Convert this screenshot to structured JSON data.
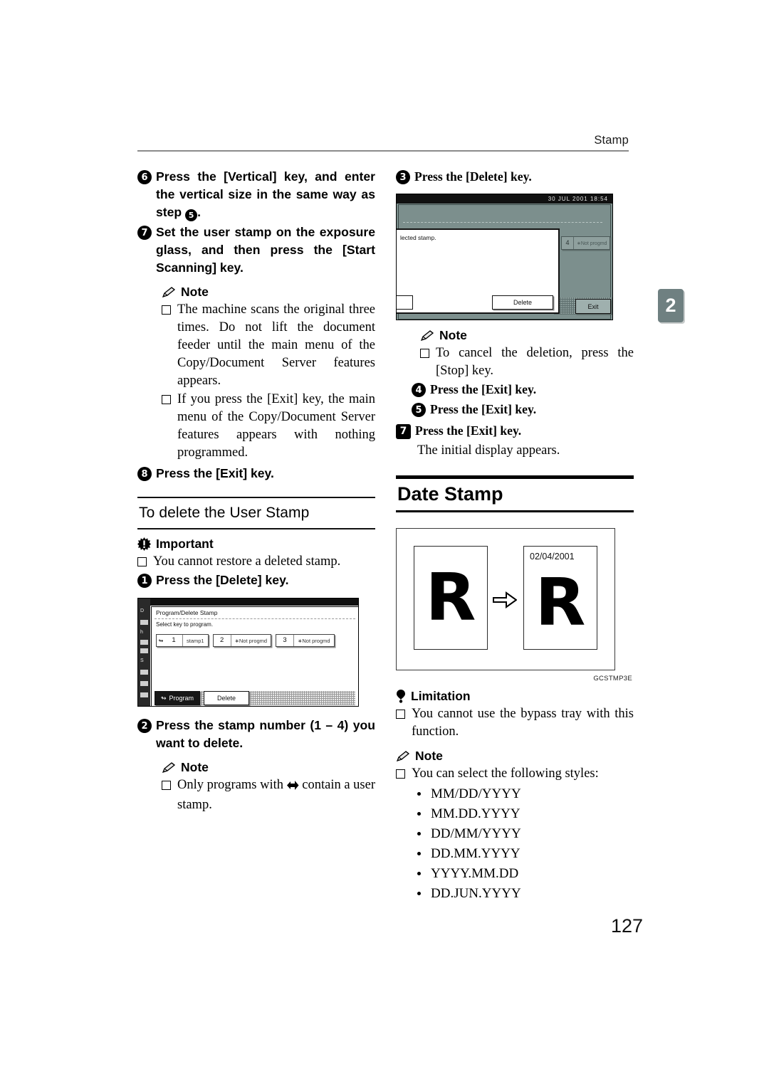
{
  "header": {
    "running_head": "Stamp",
    "chapter_tab": "2"
  },
  "folio": "127",
  "left_column": {
    "step6": {
      "badge": "6",
      "text_pre": "Press the [Vertical] key, and enter the vertical size in the same way as step ",
      "text_post": "."
    },
    "step7": {
      "badge": "7",
      "text": "Set the user stamp on the exposure glass, and then press the [Start Scanning] key."
    },
    "note1": {
      "label": "Note",
      "icon": "pencil-icon",
      "items": [
        "The machine scans the original three times. Do not lift the document feeder until the main menu of the Copy/Document Server features appears.",
        "If you press the [Exit] key, the main menu of the Copy/Document Server features appears with nothing programmed."
      ]
    },
    "step8": {
      "badge": "8",
      "text": "Press the [Exit] key."
    },
    "subsection_title": "To delete the User Stamp",
    "important": {
      "label": "Important",
      "icon": "burst-icon",
      "items": [
        "You cannot restore a deleted stamp."
      ]
    },
    "step1": {
      "badge": "1",
      "text": "Press the [Delete] key."
    },
    "lcd1": {
      "title": "Program/Delete Stamp",
      "prompt": "Select key to program.",
      "keys": [
        {
          "arrow": "↬",
          "number": "1",
          "name": "stamp1"
        },
        {
          "arrow": "",
          "number": "2",
          "name": "∗Not progmd"
        },
        {
          "arrow": "",
          "number": "3",
          "name": "∗Not progmd"
        }
      ],
      "buttons": [
        {
          "label": "Program",
          "selected": true,
          "arrow": "↬"
        },
        {
          "label": "Delete",
          "selected": false,
          "arrow": ""
        }
      ],
      "rail_labels": [
        "D",
        "h",
        "S"
      ]
    },
    "step2": {
      "badge": "2",
      "text": "Press the stamp number (1 – 4) you want to delete."
    },
    "note2": {
      "label": "Note",
      "icon": "pencil-icon",
      "item_pre": "Only programs with ",
      "item_post": " contain a user stamp."
    }
  },
  "right_column": {
    "step3": {
      "badge": "3",
      "text": "Press the [Delete] key."
    },
    "lcd2": {
      "timestamp": "30 JUL  2001  18:54",
      "dialog_message": "lected stamp.",
      "dialog_button": "Delete",
      "exit_button": "Exit",
      "back_key": {
        "number": "4",
        "name": "∗Not progmd"
      }
    },
    "note3": {
      "label": "Note",
      "icon": "pencil-icon",
      "items": [
        "To cancel the deletion, press the [Stop] key."
      ]
    },
    "step4": {
      "badge": "4",
      "text": "Press the [Exit] key."
    },
    "step5": {
      "badge": "5",
      "text": "Press the [Exit] key."
    },
    "step7_outer": {
      "badge": "7",
      "text": "Press the [Exit] key."
    },
    "step7_body": "The initial display appears.",
    "section_title": "Date Stamp",
    "figure": {
      "date_label": "02/04/2001",
      "letter_left": "R",
      "letter_right": "R",
      "caption": "GCSTMP3E"
    },
    "limitation": {
      "label": "Limitation",
      "icon": "pin-icon",
      "items": [
        "You cannot use the bypass tray with this function."
      ]
    },
    "note4": {
      "label": "Note",
      "icon": "pencil-icon",
      "intro": "You can select the following styles:",
      "styles": [
        "MM/DD/YYYY",
        "MM.DD.YYYY",
        "DD/MM/YYYY",
        "DD.MM.YYYY",
        "YYYY.MM.DD",
        "DD.JUN.YYYY"
      ]
    }
  }
}
